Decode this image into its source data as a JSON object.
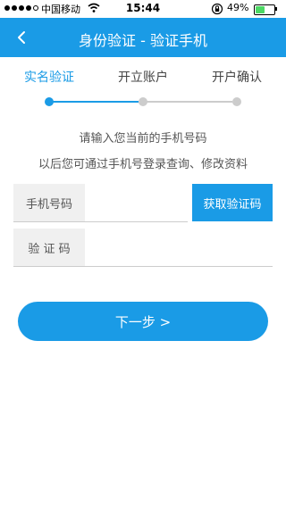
{
  "status_bar": {
    "carrier": "中国移动",
    "time": "15:44",
    "battery_text": "49%",
    "battery_level": 0.49,
    "signal_dots_filled": 4,
    "signal_dots_total": 5
  },
  "nav": {
    "back_icon": "chevron-left-icon",
    "title": "身份验证 - 验证手机"
  },
  "steps": {
    "items": [
      {
        "label": "实名验证",
        "active": true
      },
      {
        "label": "开立账户",
        "active": false
      },
      {
        "label": "开户确认",
        "active": false
      }
    ]
  },
  "hints": {
    "line1": "请输入您当前的手机号码",
    "line2": "以后您可通过手机号登录查询、修改资料"
  },
  "form": {
    "phone_label": "手机号码",
    "phone_value": "",
    "code_button": "获取验证码",
    "code_label": "验 证 码",
    "code_value": ""
  },
  "next_button": "下一步 >",
  "colors": {
    "accent": "#1a9be6",
    "inactive": "#cccccc",
    "label_bg": "#f0f0f0"
  }
}
